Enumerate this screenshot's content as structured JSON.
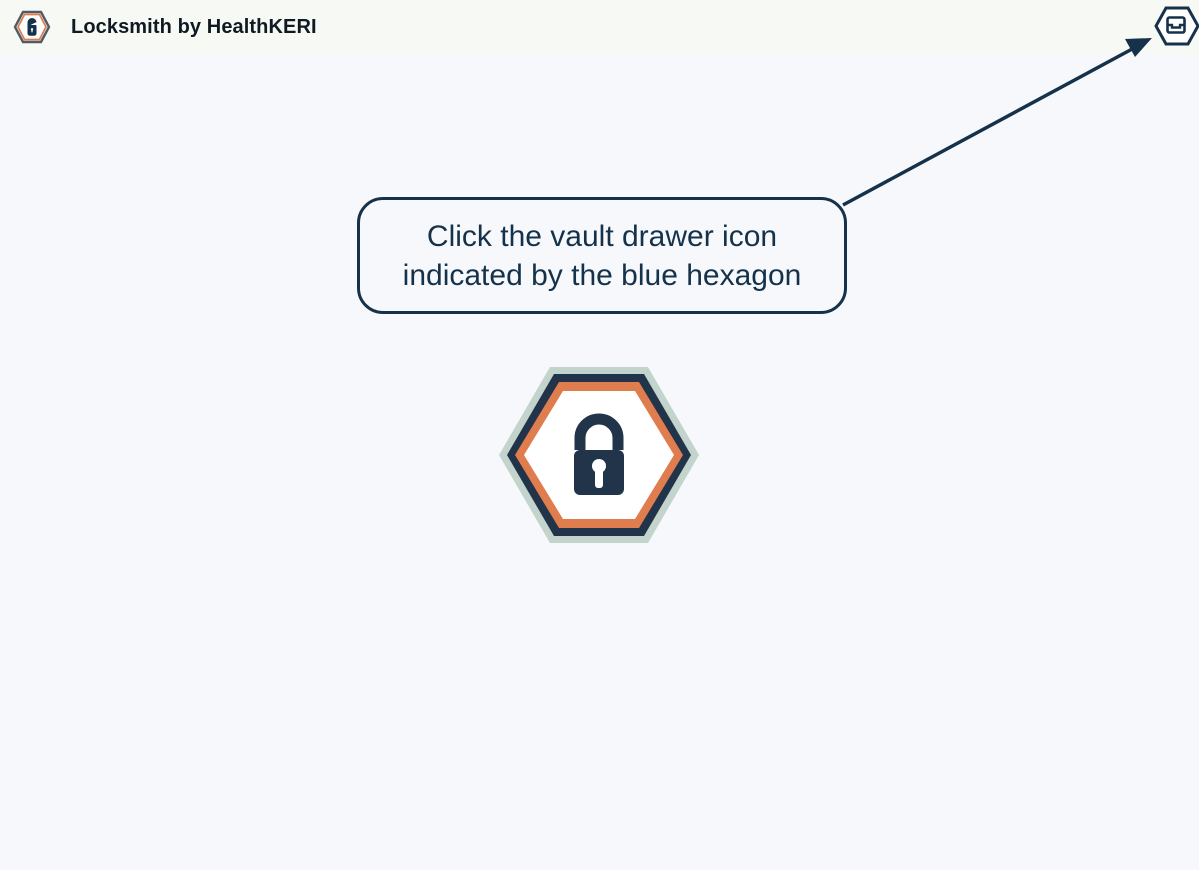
{
  "app": {
    "title": "Locksmith by HealthKERI"
  },
  "toolbar": {
    "vault_drawer_icon": "vault-drawer-icon"
  },
  "guide": {
    "callout_text": "Click the vault drawer icon\nindicated by the blue hexagon"
  },
  "colors": {
    "navy": "#15324a",
    "orange": "#e07d4f",
    "sage": "#c2d4cb",
    "background": "#f6f8fc",
    "topbar": "#f7f9f5"
  }
}
